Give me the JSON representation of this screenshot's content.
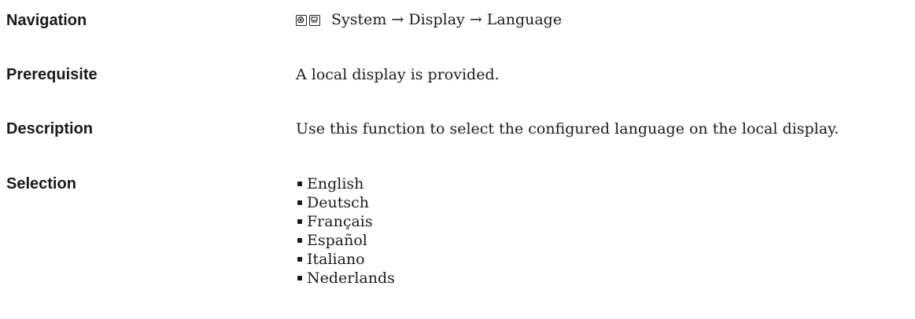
{
  "navigation": {
    "label": "Navigation",
    "icons": [
      "operating-menu-icon",
      "display-icon"
    ],
    "path": "System → Display → Language"
  },
  "prerequisite": {
    "label": "Prerequisite",
    "text": "A local display is provided."
  },
  "description": {
    "label": "Description",
    "text": "Use this function to select the configured language on the local display."
  },
  "selection": {
    "label": "Selection",
    "options": [
      "English",
      "Deutsch",
      "Français",
      "Español",
      "Italiano",
      "Nederlands"
    ]
  }
}
